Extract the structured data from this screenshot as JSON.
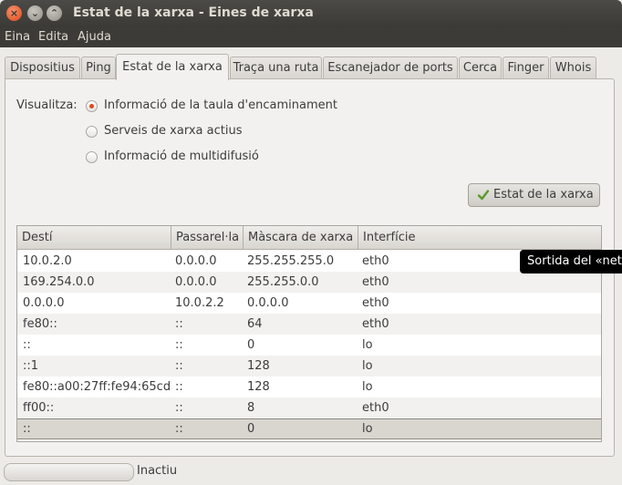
{
  "window": {
    "title": "Estat de la xarxa - Eines de xarxa",
    "buttons": {
      "close": "×",
      "minimize": "⌄",
      "maximize": "⌃"
    }
  },
  "menu": [
    "Eina",
    "Edita",
    "Ajuda"
  ],
  "tabs": [
    {
      "label": "Dispositius"
    },
    {
      "label": "Ping"
    },
    {
      "label": "Estat de la xarxa",
      "active": true
    },
    {
      "label": "Traça una ruta"
    },
    {
      "label": "Escanejador de ports"
    },
    {
      "label": "Cerca"
    },
    {
      "label": "Finger"
    },
    {
      "label": "Whois"
    }
  ],
  "view": {
    "label": "Visualitza:",
    "options": [
      {
        "label": "Informació de la taula d'encaminament",
        "selected": true
      },
      {
        "label": "Serveis de xarxa actius",
        "selected": false
      },
      {
        "label": "Informació de multidifusió",
        "selected": false
      }
    ]
  },
  "action_button": {
    "label": "Estat de la xarxa",
    "icon": "check-icon"
  },
  "table": {
    "columns": [
      "Destí",
      "Passarel·la",
      "Màscara de xarxa",
      "Interfície"
    ],
    "rows": [
      [
        "10.0.2.0",
        "0.0.0.0",
        "255.255.255.0",
        "eth0"
      ],
      [
        "169.254.0.0",
        "0.0.0.0",
        "255.255.0.0",
        "eth0"
      ],
      [
        "0.0.0.0",
        "10.0.2.2",
        "0.0.0.0",
        "eth0"
      ],
      [
        "fe80::",
        "::",
        "64",
        "eth0"
      ],
      [
        "::",
        "::",
        "0",
        "lo"
      ],
      [
        "::1",
        "::",
        "128",
        "lo"
      ],
      [
        "fe80::a00:27ff:fe94:65cd",
        "::",
        "128",
        "lo"
      ],
      [
        "ff00::",
        "::",
        "8",
        "eth0"
      ],
      [
        "::",
        "::",
        "0",
        "lo"
      ]
    ],
    "selected_row": 8
  },
  "tooltip": "Sortida del «net",
  "status": {
    "text": "Inactiu"
  },
  "colors": {
    "accent": "#df4a17",
    "titlebar": "#3c3b37",
    "tooltip_bg": "#000000"
  }
}
